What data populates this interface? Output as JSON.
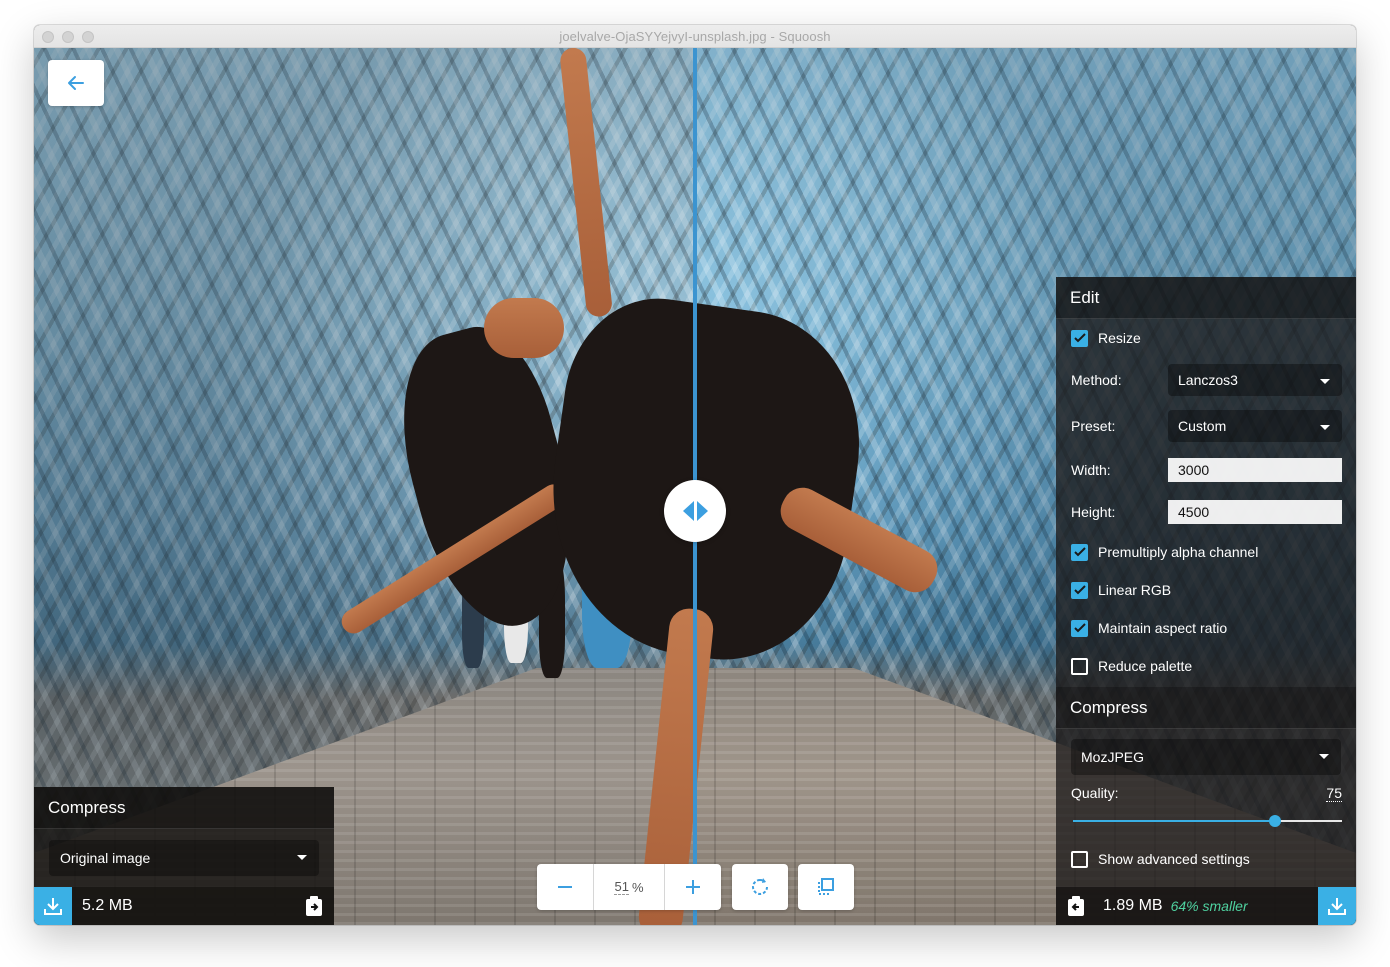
{
  "window": {
    "title": "joelvalve-OjaSYYejvyI-unsplash.jpg - Squoosh"
  },
  "colors": {
    "accent": "#3ab0e5",
    "divider": "#3c94d0",
    "savings_text": "#4fd2a0",
    "panel_bg": "#1c1a19"
  },
  "viewer": {
    "back_icon": "arrow-left-icon",
    "handle_icon": "split-handle-icon",
    "zoom": {
      "zoom_out_icon": "minus-icon",
      "value": "51",
      "unit": "%",
      "zoom_in_icon": "plus-icon"
    },
    "rotate_icon": "rotate-icon",
    "background_toggle_icon": "background-toggle-icon"
  },
  "left_panel": {
    "heading": "Compress",
    "codec": "Original image",
    "size": "5.2 MB",
    "download_icon": "download-icon",
    "copy_icon": "copy-to-other-side-icon"
  },
  "right_panel": {
    "edit_heading": "Edit",
    "resize": {
      "label": "Resize",
      "checked": true
    },
    "method": {
      "label": "Method:",
      "value": "Lanczos3"
    },
    "preset": {
      "label": "Preset:",
      "value": "Custom"
    },
    "width": {
      "label": "Width:",
      "value": "3000"
    },
    "height": {
      "label": "Height:",
      "value": "4500"
    },
    "premultiply": {
      "label": "Premultiply alpha channel",
      "checked": true
    },
    "linear_rgb": {
      "label": "Linear RGB",
      "checked": true
    },
    "maintain_aspect": {
      "label": "Maintain aspect ratio",
      "checked": true
    },
    "reduce_palette": {
      "label": "Reduce palette",
      "checked": false
    },
    "compress_heading": "Compress",
    "codec": "MozJPEG",
    "quality": {
      "label": "Quality:",
      "value": "75",
      "fraction": 0.75
    },
    "advanced": {
      "label": "Show advanced settings",
      "checked": false
    },
    "size": "1.89 MB",
    "savings": "64% smaller",
    "download_icon": "download-icon",
    "copy_icon": "copy-to-other-side-icon"
  }
}
